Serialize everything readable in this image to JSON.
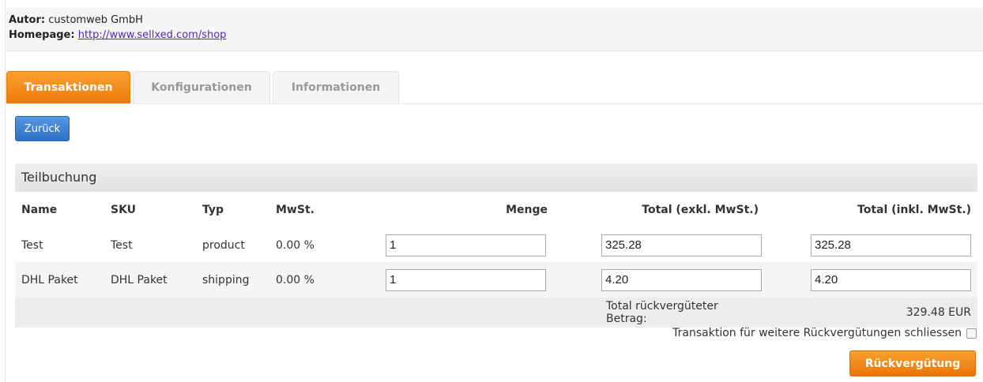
{
  "info": {
    "author_label": "Autor:",
    "author_value": "customweb GmbH",
    "homepage_label": "Homepage:",
    "homepage_url": "http://www.sellxed.com/shop"
  },
  "tabs": [
    {
      "label": "Transaktionen",
      "active": true
    },
    {
      "label": "Konfigurationen",
      "active": false
    },
    {
      "label": "Informationen",
      "active": false
    }
  ],
  "back_button": "Zurück",
  "panel": {
    "title": "Teilbuchung",
    "columns": [
      "Name",
      "SKU",
      "Typ",
      "MwSt.",
      "Menge",
      "Total (exkl. MwSt.)",
      "Total (inkl. MwSt.)"
    ],
    "rows": [
      {
        "name": "Test",
        "sku": "Test",
        "type": "product",
        "tax": "0.00 %",
        "qty": "1",
        "total_excl": "325.28",
        "total_incl": "325.28"
      },
      {
        "name": "DHL Paket",
        "sku": "DHL Paket",
        "type": "shipping",
        "tax": "0.00 %",
        "qty": "1",
        "total_excl": "4.20",
        "total_incl": "4.20"
      }
    ],
    "total_label": "Total rückvergüteter Betrag:",
    "total_value": "329.48 EUR"
  },
  "close_label": "Transaktion für weitere Rückvergütungen schliessen",
  "close_checked": false,
  "refund_button": "Rückvergütung",
  "colors": {
    "accent_orange": "#f18a1c",
    "button_blue": "#3f82d6"
  }
}
